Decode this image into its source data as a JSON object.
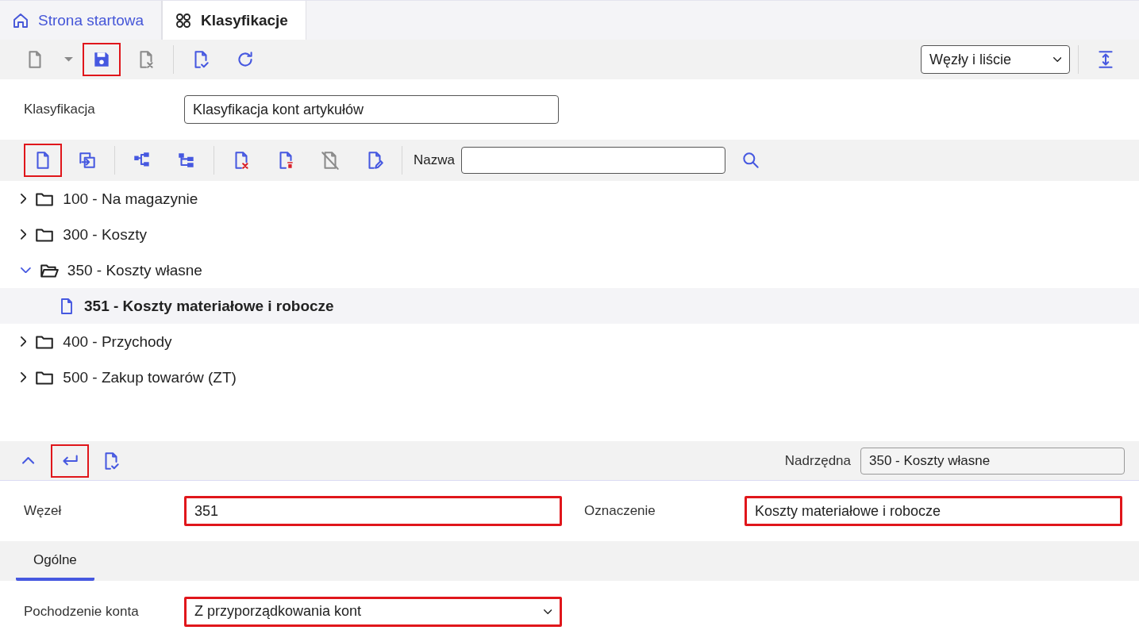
{
  "tabs": [
    {
      "label": "Strona startowa",
      "kind": "home",
      "selected": false
    },
    {
      "label": "Klasyfikacje",
      "kind": "grid",
      "selected": true
    }
  ],
  "main_toolbar": {
    "groups": [
      [
        {
          "kind": "doc",
          "disabled": true,
          "highlighted": false
        },
        {
          "kind": "caret",
          "disabled": true,
          "highlighted": false
        },
        {
          "kind": "save",
          "disabled": false,
          "highlighted": true
        },
        {
          "kind": "docx",
          "disabled": true,
          "highlighted": false
        }
      ],
      [
        {
          "kind": "doccheck",
          "disabled": false,
          "highlighted": false
        },
        {
          "kind": "refresh",
          "disabled": false,
          "highlighted": false
        }
      ]
    ],
    "view_select": "Węzły i liście"
  },
  "classification": {
    "label": "Klasyfikacja",
    "value": "Klasyfikacja kont artykułów"
  },
  "tree_toolbar": {
    "groups": [
      [
        {
          "kind": "doc",
          "disabled": false,
          "highlighted": true
        },
        {
          "kind": "copyin",
          "disabled": false,
          "highlighted": false
        }
      ],
      [
        {
          "kind": "tree",
          "disabled": false,
          "highlighted": false
        },
        {
          "kind": "tree2",
          "disabled": false,
          "highlighted": false
        }
      ],
      [
        {
          "kind": "docdel",
          "disabled": false,
          "highlighted": false
        },
        {
          "kind": "doctrash",
          "disabled": false,
          "highlighted": false
        },
        {
          "kind": "docoff",
          "disabled": true,
          "highlighted": false
        },
        {
          "kind": "docedit",
          "disabled": false,
          "highlighted": false
        }
      ]
    ],
    "search_label": "Nazwa"
  },
  "tree": [
    {
      "label": "100 - Na magazynie",
      "expanded": false,
      "selected": false
    },
    {
      "label": "300 - Koszty",
      "expanded": false,
      "selected": false
    },
    {
      "label": "350 - Koszty własne",
      "expanded": true,
      "selected": false,
      "children": [
        {
          "label": "351 - Koszty materiałowe i robocze",
          "selected": true
        }
      ]
    },
    {
      "label": "400 - Przychody",
      "expanded": false,
      "selected": false
    },
    {
      "label": "500 - Zakup towarów (ZT)",
      "expanded": false,
      "selected": false
    }
  ],
  "detail_toolbar": {
    "buttons": [
      {
        "kind": "chevup",
        "disabled": false,
        "highlighted": false
      },
      {
        "kind": "return",
        "disabled": false,
        "highlighted": true
      },
      {
        "kind": "doccheck",
        "disabled": false,
        "highlighted": false
      }
    ],
    "parent_label": "Nadrzędna",
    "parent_value": "350 - Koszty własne"
  },
  "fields": [
    {
      "label": "Węzeł",
      "value": "351",
      "highlighted": true
    },
    {
      "label": "Oznaczenie",
      "value": "Koszty materiałowe i robocze",
      "highlighted": true
    }
  ],
  "subtabs": [
    {
      "label": "Ogólne",
      "selected": true
    }
  ],
  "origin": {
    "label": "Pochodzenie konta",
    "value": "Z przyporządkowania kont",
    "highlighted": true
  }
}
